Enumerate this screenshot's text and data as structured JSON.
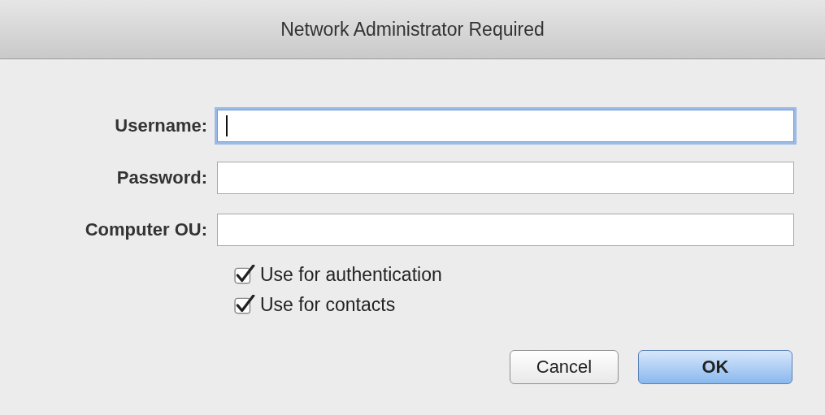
{
  "window": {
    "title": "Network Administrator Required"
  },
  "fields": [
    {
      "label": "Username:",
      "focused": true
    },
    {
      "label": "Password:",
      "focused": false
    },
    {
      "label": "Computer OU:",
      "focused": false
    }
  ],
  "checkboxes": [
    {
      "label": "Use for authentication",
      "checked": true
    },
    {
      "label": "Use for contacts",
      "checked": true
    }
  ],
  "buttons": [
    {
      "label": "Cancel",
      "default": false
    },
    {
      "label": "OK",
      "default": true
    }
  ]
}
